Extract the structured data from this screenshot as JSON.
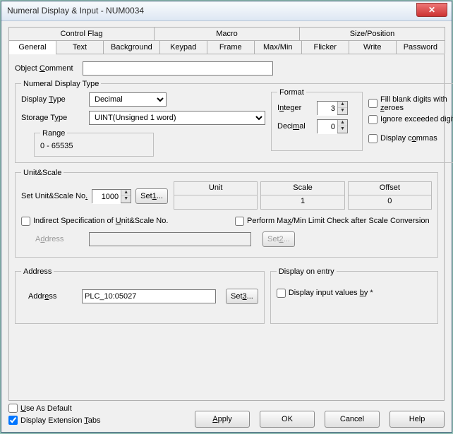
{
  "window": {
    "title": "Numeral Display & Input - NUM0034"
  },
  "tabs_upper": [
    {
      "label": "Control Flag"
    },
    {
      "label": "Macro"
    },
    {
      "label": "Size/Position"
    }
  ],
  "tabs_lower": [
    {
      "label": "General",
      "active": true
    },
    {
      "label": "Text"
    },
    {
      "label": "Background"
    },
    {
      "label": "Keypad"
    },
    {
      "label": "Frame"
    },
    {
      "label": "Max/Min"
    },
    {
      "label": "Flicker"
    },
    {
      "label": "Write"
    },
    {
      "label": "Password"
    }
  ],
  "object_comment": {
    "label_pre": "Object ",
    "label_u": "C",
    "label_post": "omment",
    "value": ""
  },
  "numeral_display": {
    "legend": "Numeral Display Type",
    "display_type": {
      "label_pre": "Display ",
      "label_u": "T",
      "label_post": "ype",
      "value": "Decimal"
    },
    "storage_type": {
      "label_pre": "Storage T",
      "label_u": "y",
      "label_post": "pe",
      "value": "UINT(Unsigned 1 word)"
    },
    "range": {
      "legend": "Range",
      "value": "0 - 65535"
    },
    "format": {
      "legend": "Format",
      "integer": {
        "label_pre": "I",
        "label_u": "n",
        "label_post": "teger",
        "value": "3"
      },
      "decimal": {
        "label_pre": "Deci",
        "label_u": "m",
        "label_post": "al",
        "value": "0"
      }
    },
    "opts": {
      "fill_zeroes": {
        "pre": "Fill blank digits with ",
        "u": "z",
        "post": "eroes"
      },
      "ignore_exceeded": {
        "pre": "I",
        "u": "g",
        "post": "nore exceeded digits"
      },
      "display_commas": {
        "pre": "Display c",
        "u": "o",
        "post": "mmas"
      }
    }
  },
  "unitscale": {
    "legend": "Unit&Scale",
    "set_label": {
      "pre": "Set Unit&Scale No",
      "u": ".",
      "post": ""
    },
    "set_value": "1000",
    "set_btn": {
      "pre": "Set",
      "u": "1",
      "post": "..."
    },
    "unit": {
      "header": "Unit",
      "value": ""
    },
    "scale": {
      "header": "Scale",
      "value": "1"
    },
    "offset": {
      "header": "Offset",
      "value": "0"
    },
    "indirect": {
      "pre": "Indirect Specification of ",
      "u": "U",
      "post": "nit&Scale No."
    },
    "perform": {
      "pre": "Perform Ma",
      "u": "x",
      "post": "/Min Limit Check after Scale Conversion"
    },
    "address_lbl": {
      "pre": "A",
      "u": "d",
      "post": "dress"
    },
    "set2": {
      "pre": "Set",
      "u": "2",
      "post": "..."
    }
  },
  "addr": {
    "legend": "Address",
    "label_pre": "Addr",
    "label_u": "e",
    "label_post": "ss",
    "value": "PLC_10:05027",
    "set3": {
      "pre": "Set",
      "u": "3",
      "post": "..."
    }
  },
  "display_entry": {
    "legend": "Display on entry",
    "cb": {
      "pre": "Display input values ",
      "u": "b",
      "post": "y *"
    }
  },
  "bottom": {
    "use_default": {
      "pre": "",
      "u": "U",
      "post": "se As Default"
    },
    "ext_tabs": {
      "pre": "Display Extension ",
      "u": "T",
      "post": "abs"
    },
    "apply": {
      "pre": "",
      "u": "A",
      "post": "pply"
    },
    "ok": "OK",
    "cancel": "Cancel",
    "help": "Help"
  }
}
